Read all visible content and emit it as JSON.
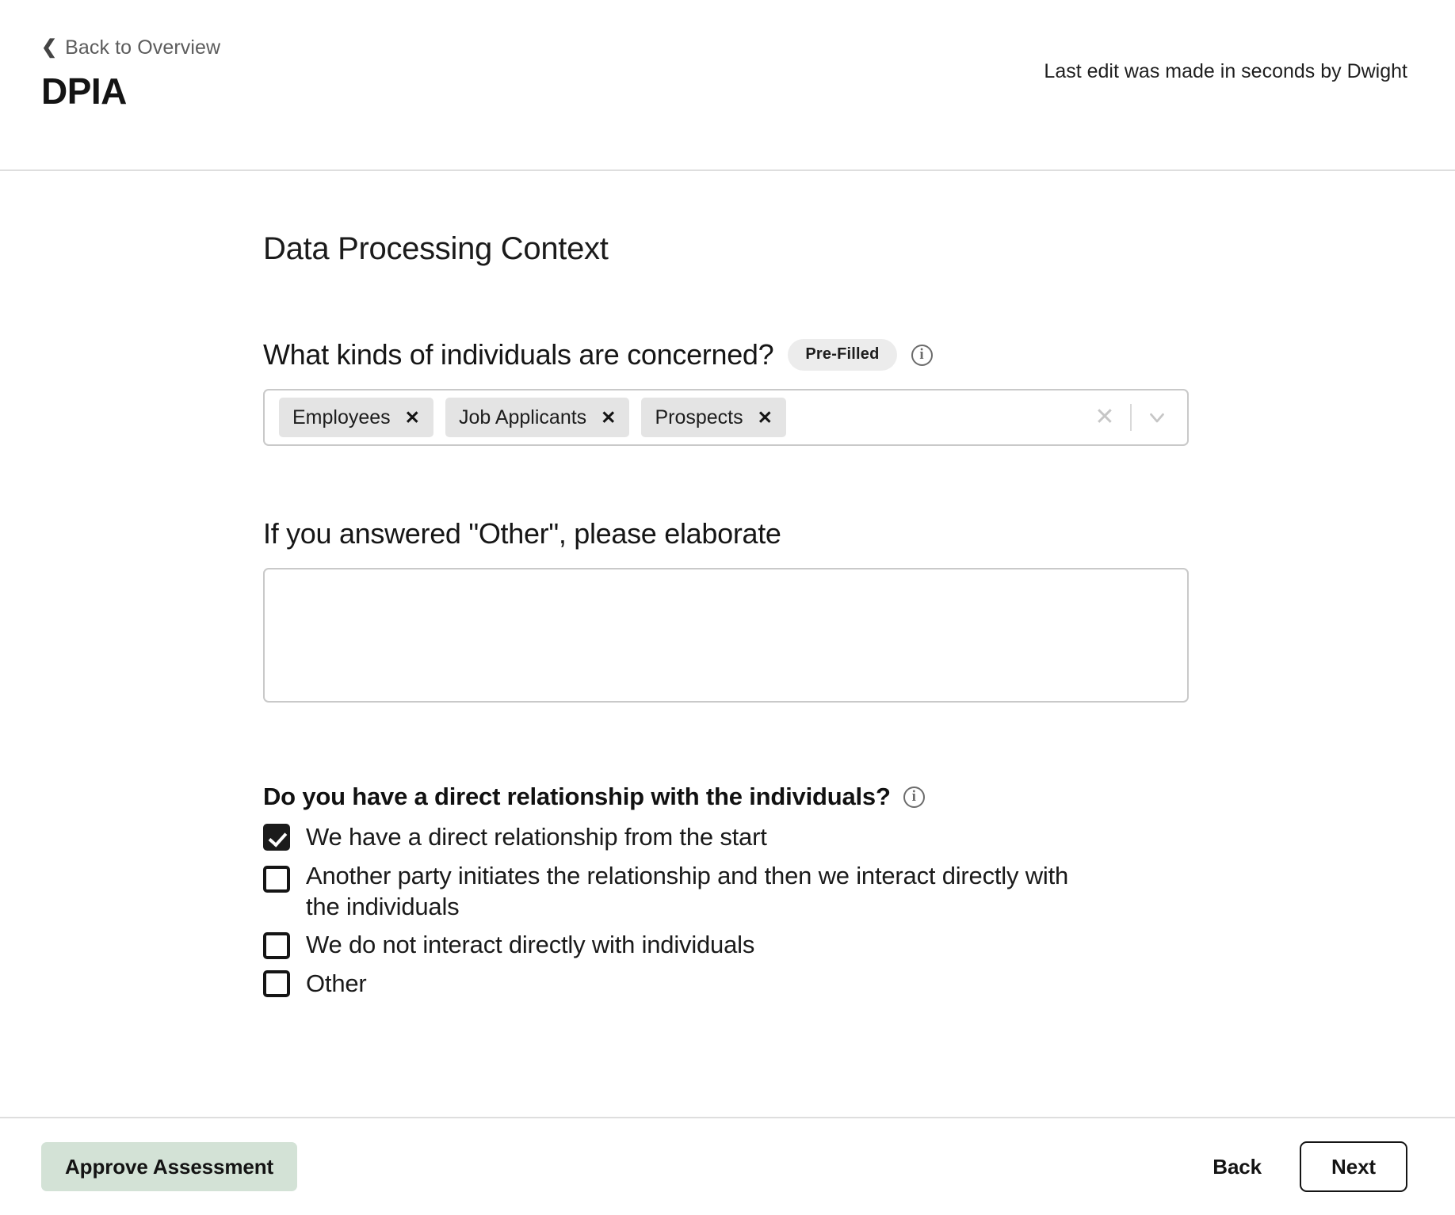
{
  "header": {
    "back_label": "Back to Overview",
    "back_icon": "chevron-left-icon",
    "title": "DPIA",
    "last_edit": "Last edit was made in seconds by Dwight"
  },
  "main": {
    "section_title": "Data Processing Context",
    "question_one": {
      "label": "What kinds of individuals are concerned?",
      "badge": "Pre-Filled",
      "info_icon": "info-icon",
      "selected_tags": [
        {
          "label": "Employees",
          "remove_icon": "✕"
        },
        {
          "label": "Job Applicants",
          "remove_icon": "✕"
        },
        {
          "label": "Prospects",
          "remove_icon": "✕"
        }
      ],
      "clear_all_icon": "✕",
      "dropdown_icon": "chevron-down-icon"
    },
    "elaborate": {
      "label": "If you answered \"Other\", please elaborate",
      "value": "",
      "placeholder": ""
    },
    "relationship": {
      "label": "Do you have a direct relationship with the individuals?",
      "info_icon": "info-icon",
      "options": [
        {
          "label": "We have a direct relationship from the start",
          "checked": true
        },
        {
          "label": "Another party initiates the relationship and then we interact directly with the individuals",
          "checked": false
        },
        {
          "label": "We do not interact directly with individuals",
          "checked": false
        },
        {
          "label": "Other",
          "checked": false
        }
      ]
    }
  },
  "footer": {
    "approve_label": "Approve Assessment",
    "back_label": "Back",
    "next_label": "Next"
  },
  "colors": {
    "approve_bg": "#d3e2d6",
    "tag_bg": "#e4e4e4",
    "badge_bg": "#ececec",
    "border": "#c9c9c9",
    "divider": "#dedede",
    "text": "#1a1a1a"
  }
}
